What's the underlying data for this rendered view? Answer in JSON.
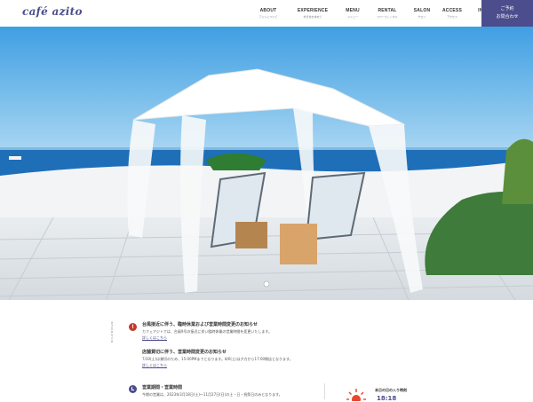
{
  "header": {
    "logo": "café azito",
    "nav": [
      {
        "en": "ABOUT",
        "jp": "アジトについて"
      },
      {
        "en": "EXPERIENCE",
        "jp": "非日常を求めて"
      },
      {
        "en": "MENU",
        "jp": "メニュー"
      },
      {
        "en": "RENTAL",
        "jp": "スペースレンタル"
      },
      {
        "en": "SALON",
        "jp": "サロン"
      },
      {
        "en": "ACCESS",
        "jp": "アクセス"
      },
      {
        "en": "INSTAGRAM",
        "jp": "インスタグラム"
      }
    ],
    "reserve_line1": "ご予約",
    "reserve_line2": "お問合わせ"
  },
  "news": {
    "vertical_label": "INFORMATION",
    "item1_title": "台風接近に伴う、臨時休業および営業時間変更のお知らせ",
    "item1_text": "カフェアジトでは、台風9号の接近に伴い臨時休業の営業時間を変更いたします。",
    "item1_link": "詳しくはこちら",
    "item2_title": "店舗貸切に伴う、営業時間変更のお知らせ",
    "item2_text": "7/30(土)は貸切のため、15:00PMまでとなります。8/6(土)は夕方から17:00閉店となります。",
    "item2_link": "詳しくはこちら",
    "item3_title": "営業期間・営業時間",
    "item3_text": "今期の営業は、2023年3月18日(土)～11月27日(日)の土・日・祝祭日のみとなります。"
  },
  "sunset": {
    "label": "本日の日の入り時刻",
    "time": "18:18"
  },
  "colors": {
    "brand": "#4b4d8c",
    "alert": "#c0392b",
    "sky": "#4aa7e6",
    "sea": "#1e6fb8"
  }
}
